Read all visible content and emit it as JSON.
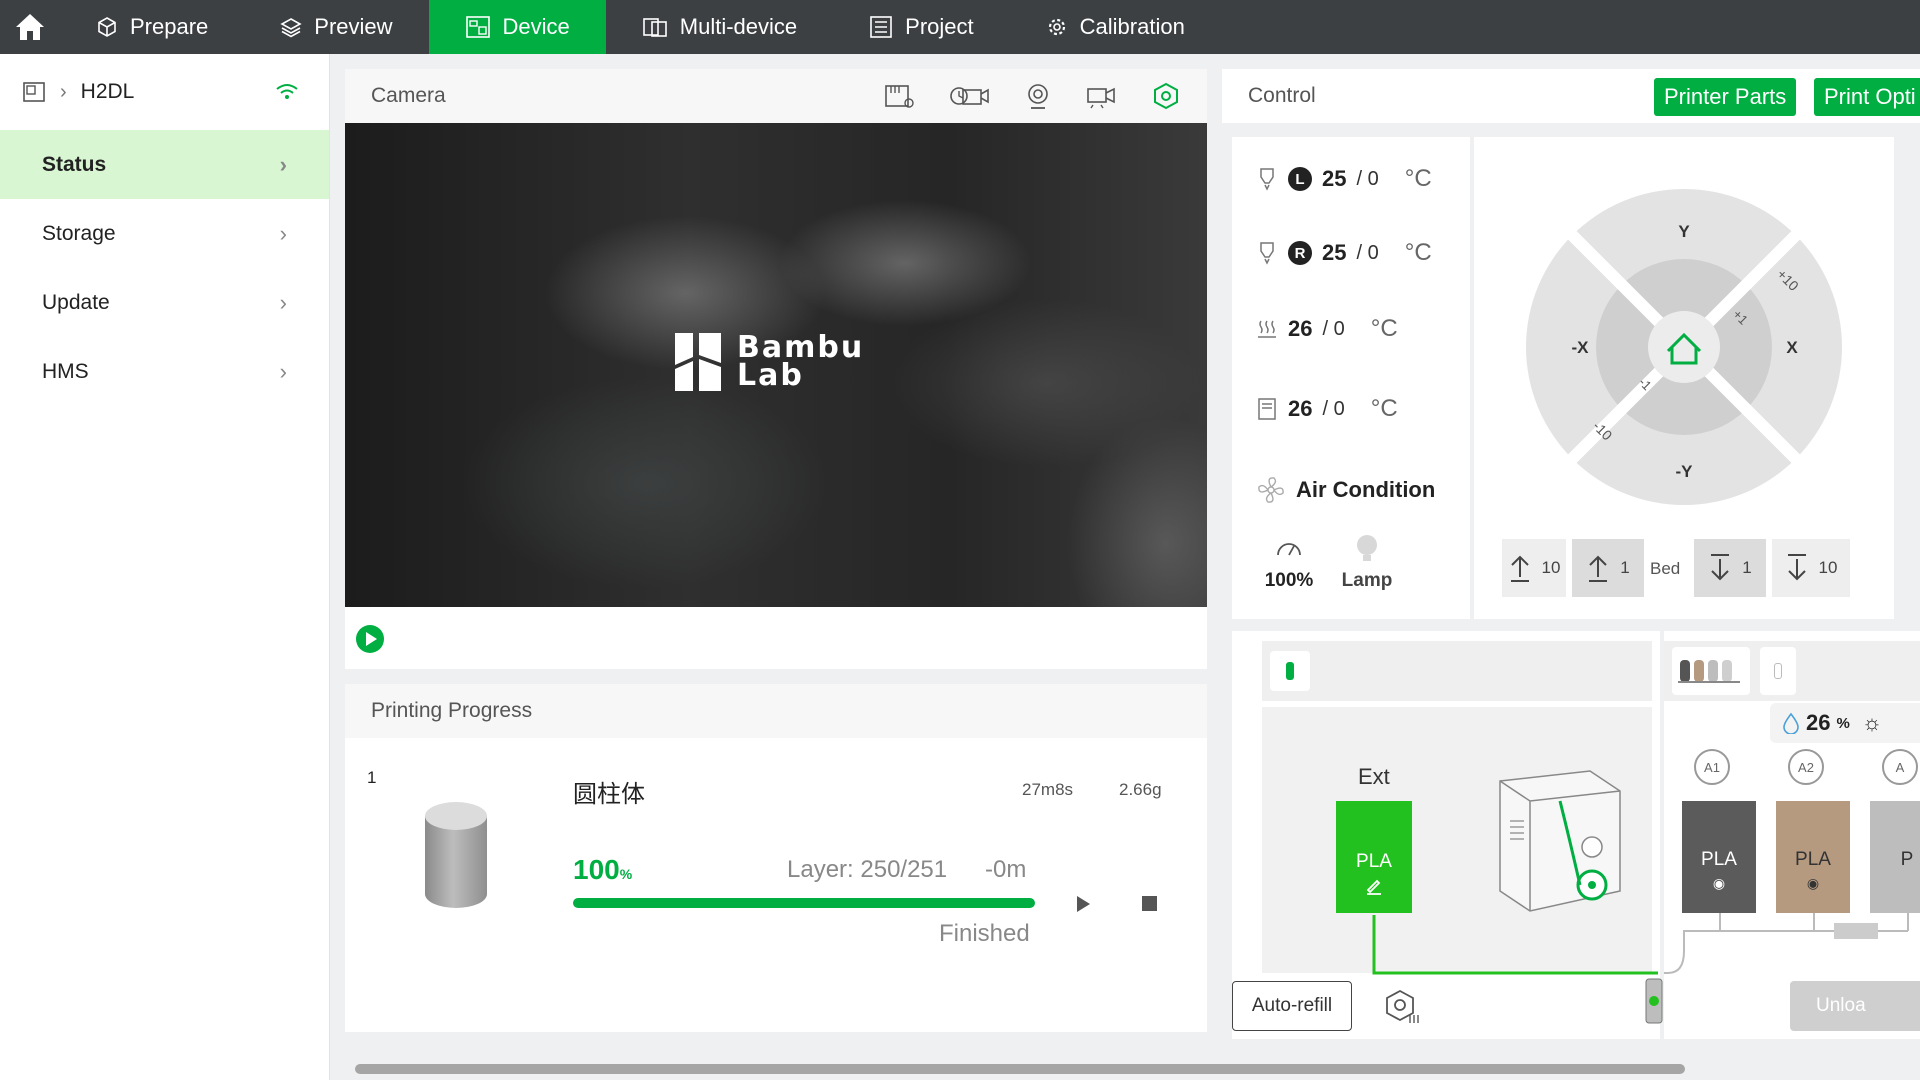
{
  "nav": {
    "tabs": [
      {
        "label": "Prepare"
      },
      {
        "label": "Preview"
      },
      {
        "label": "Device"
      },
      {
        "label": "Multi-device"
      },
      {
        "label": "Project"
      },
      {
        "label": "Calibration"
      }
    ],
    "active": "Device",
    "accent": "#00ae42"
  },
  "sidebar": {
    "printer_name": "H2DL",
    "items": [
      {
        "label": "Status"
      },
      {
        "label": "Storage"
      },
      {
        "label": "Update"
      },
      {
        "label": "HMS"
      }
    ]
  },
  "camera": {
    "title": "Camera",
    "logo_line1": "Bambu",
    "logo_line2": "Lab"
  },
  "progress": {
    "title": "Printing Progress",
    "plate": "1",
    "name": "圆柱体",
    "time": "27m8s",
    "weight": "2.66g",
    "percent": "100",
    "percent_unit": "%",
    "layer": "Layer: 250/251",
    "remaining": "-0m",
    "status": "Finished",
    "progress_fraction": 1.0
  },
  "control": {
    "title": "Control",
    "printer_parts": "Printer Parts",
    "print_options": "Print Opti",
    "left_nozzle": {
      "badge": "L",
      "current": "25",
      "target": "/ 0",
      "unit": "°C"
    },
    "right_nozzle": {
      "badge": "R",
      "current": "25",
      "target": "/ 0",
      "unit": "°C"
    },
    "bed": {
      "current": "26",
      "target": "/ 0",
      "unit": "°C"
    },
    "chamber": {
      "current": "26",
      "target": "/ 0",
      "unit": "°C"
    },
    "air_condition": "Air Condition",
    "speed": "100%",
    "lamp": "Lamp",
    "joystick": {
      "y": "Y",
      "neg_y": "-Y",
      "x": "X",
      "neg_x": "-X",
      "p10": "+10",
      "p1": "+1",
      "m1": "-1",
      "m10": "-10"
    },
    "z_buttons": {
      "up10": "10",
      "up1": "1",
      "bed": "Bed",
      "down1": "1",
      "down10": "10"
    }
  },
  "ams": {
    "ext_label": "Ext",
    "ext_filament": "PLA",
    "humidity": "26",
    "humidity_unit": "%",
    "slots": [
      {
        "label": "A1",
        "filament": "PLA",
        "color": "#5b5b5b"
      },
      {
        "label": "A2",
        "filament": "PLA",
        "color": "#b59a80"
      },
      {
        "label": "A",
        "filament": "P",
        "color": "#bdbdbd"
      }
    ],
    "auto_refill": "Auto-refill",
    "unload": "Unloa"
  }
}
